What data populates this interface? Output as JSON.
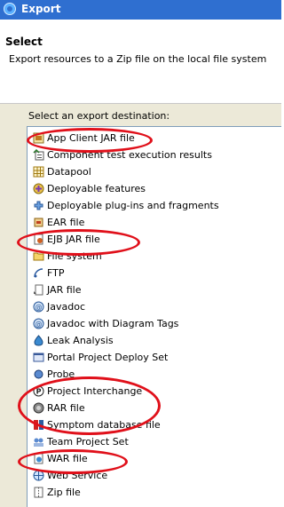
{
  "window": {
    "title": "Export"
  },
  "header": {
    "title": "Select",
    "description": "Export resources to a Zip file on the local file system"
  },
  "destination_label": "Select an export destination:",
  "items": [
    {
      "label": "App Client JAR file",
      "icon": "jar-icon"
    },
    {
      "label": "Component test execution results",
      "icon": "results-icon"
    },
    {
      "label": "Datapool",
      "icon": "table-icon"
    },
    {
      "label": "Deployable features",
      "icon": "feature-icon"
    },
    {
      "label": "Deployable plug-ins and fragments",
      "icon": "plugin-icon"
    },
    {
      "label": "EAR file",
      "icon": "ear-icon"
    },
    {
      "label": "EJB JAR file",
      "icon": "ejb-icon"
    },
    {
      "label": "File system",
      "icon": "folder-icon"
    },
    {
      "label": "FTP",
      "icon": "ftp-icon"
    },
    {
      "label": "JAR file",
      "icon": "jar-file-icon"
    },
    {
      "label": "Javadoc",
      "icon": "javadoc-icon"
    },
    {
      "label": "Javadoc with Diagram Tags",
      "icon": "javadoc-icon"
    },
    {
      "label": "Leak Analysis",
      "icon": "leak-icon"
    },
    {
      "label": "Portal Project Deploy Set",
      "icon": "portal-icon"
    },
    {
      "label": "Probe",
      "icon": "probe-icon"
    },
    {
      "label": "Project Interchange",
      "icon": "interchange-icon"
    },
    {
      "label": "RAR file",
      "icon": "rar-icon"
    },
    {
      "label": "Symptom database file",
      "icon": "symptom-icon"
    },
    {
      "label": "Team Project Set",
      "icon": "team-icon"
    },
    {
      "label": "WAR file",
      "icon": "war-icon"
    },
    {
      "label": "Web Service",
      "icon": "webservice-icon"
    },
    {
      "label": "Zip file",
      "icon": "zip-icon"
    }
  ],
  "colors": {
    "titlebar": "#2f6fd0",
    "highlight_ring": "#e0101a",
    "list_border": "#7f9db9"
  }
}
